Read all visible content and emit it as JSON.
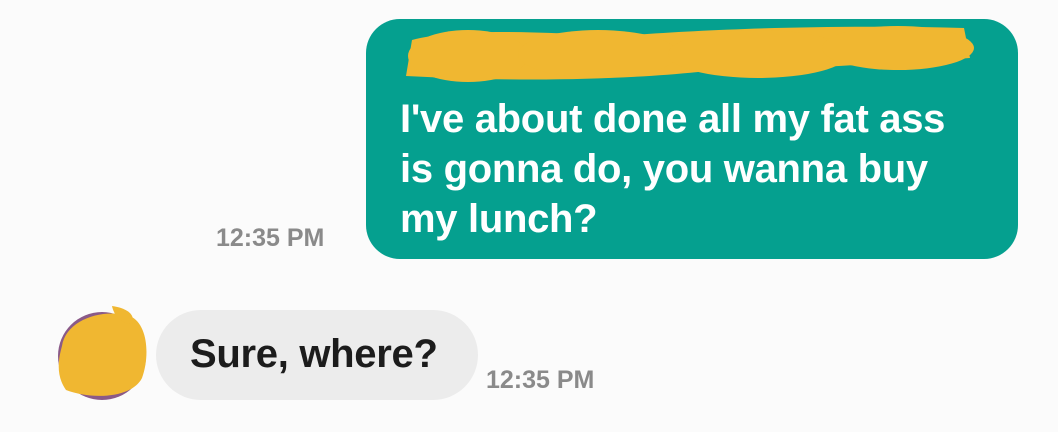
{
  "conversation": {
    "sent_message": {
      "text": "I've about done all my fat ass\nis gonna do, you wanna buy\nmy lunch?",
      "time": "12:35 PM",
      "bubble_color": "#05a08f",
      "redacted_line": true
    },
    "received_message": {
      "text": "Sure, where?",
      "time": "12:35 PM",
      "bubble_color": "#ececec",
      "avatar_redacted": true
    },
    "redaction_color": "#f0b731"
  }
}
